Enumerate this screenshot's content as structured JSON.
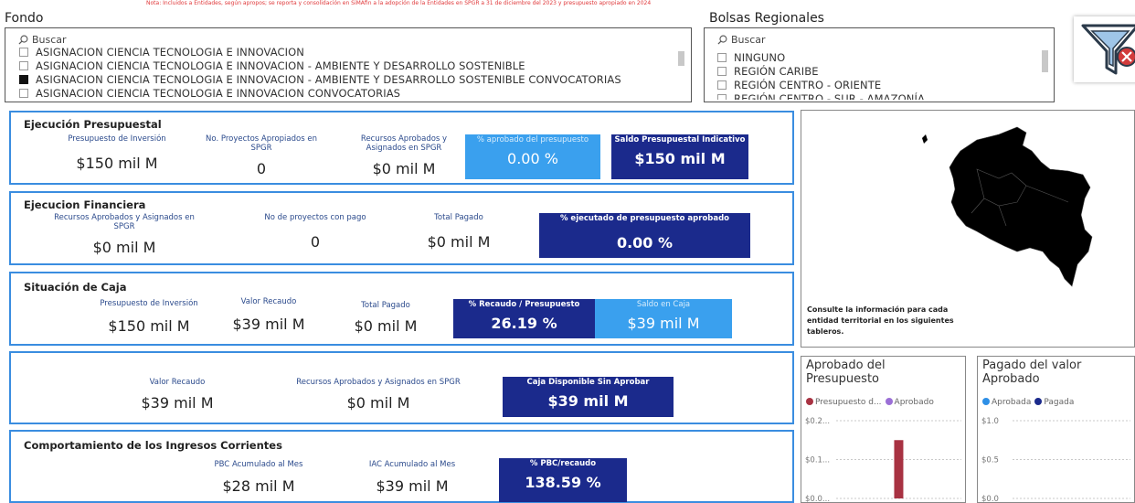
{
  "top_note": "Nota: Incluidos a Entidades, según apropos; se reporta y consolidación en SiMAfin a la adopción de la Entidades en SPGR a 31 de diciembre del 2023 y presupuesto apropiado en 2024",
  "fondo": {
    "title": "Fondo",
    "search_placeholder": "Buscar",
    "items": [
      {
        "label": "ASIGNACION CIENCIA TECNOLOGIA E INNOVACION",
        "checked": false
      },
      {
        "label": "ASIGNACION CIENCIA TECNOLOGIA E INNOVACION - AMBIENTE Y DESARROLLO SOSTENIBLE",
        "checked": false
      },
      {
        "label": "ASIGNACION CIENCIA TECNOLOGIA E INNOVACION - AMBIENTE Y DESARROLLO SOSTENIBLE CONVOCATORIAS",
        "checked": true
      },
      {
        "label": "ASIGNACION CIENCIA TECNOLOGIA E INNOVACION CONVOCATORIAS",
        "checked": false
      }
    ]
  },
  "bolsas": {
    "title": "Bolsas Regionales",
    "search_placeholder": "Buscar",
    "items": [
      {
        "label": "NINGUNO",
        "checked": false
      },
      {
        "label": "REGIÓN CARIBE",
        "checked": false
      },
      {
        "label": "REGIÓN CENTRO - ORIENTE",
        "checked": false
      },
      {
        "label": "REGIÓN CENTRO - SUR - AMAZONÍA",
        "checked": false
      }
    ]
  },
  "ejecucion_presupuestal": {
    "title": "Ejecución Presupuestal",
    "presupuesto_label": "Presupuesto de Inversión",
    "presupuesto_value": "$150 mil M",
    "proyectos_label": "No. Proyectos Apropiados en SPGR",
    "proyectos_value": "0",
    "recursos_label": "Recursos Aprobados y Asignados en SPGR",
    "recursos_value": "$0 mil M",
    "pct_label": "% aprobado del presupuesto",
    "pct_value": "0.00 %",
    "saldo_label": "Saldo Presupuestal Indicativo",
    "saldo_value": "$150 mil M"
  },
  "ejecucion_financiera": {
    "title": "Ejecucion Financiera",
    "recursos_label": "Recursos Aprobados y Asignados en SPGR",
    "recursos_value": "$0 mil M",
    "proyectos_label": "No de proyectos con pago",
    "proyectos_value": "0",
    "pagado_label": "Total Pagado",
    "pagado_value": "$0 mil M",
    "pct_label": "% ejecutado de presupuesto aprobado",
    "pct_value": "0.00 %"
  },
  "situacion_caja": {
    "title": "Situación de Caja",
    "presupuesto_label": "Presupuesto de Inversión",
    "presupuesto_value": "$150 mil M",
    "recaudo_label": "Valor Recaudo",
    "recaudo_value": "$39 mil M",
    "pagado_label": "Total Pagado",
    "pagado_value": "$0 mil M",
    "pct_label": "% Recaudo / Presupuesto",
    "pct_value": "26.19 %",
    "saldo_label": "Saldo en Caja",
    "saldo_value": "$39 mil M"
  },
  "caja_disponible": {
    "recaudo_label": "Valor Recaudo",
    "recaudo_value": "$39 mil M",
    "recursos_label": "Recursos Aprobados y Asignados en SPGR",
    "recursos_value": "$0 mil M",
    "caja_label": "Caja Disponible Sin Aprobar",
    "caja_value": "$39 mil M"
  },
  "ingresos_corrientes": {
    "title": "Comportamiento de los Ingresos Corrientes",
    "pbc_label": "PBC Acumulado al Mes",
    "pbc_value": "$28 mil M",
    "iac_label": "IAC Acumulado al Mes",
    "iac_value": "$39 mil M",
    "pct_label": "% PBC/recaudo",
    "pct_value": "138.59 %"
  },
  "map": {
    "note": "Consulte la información para cada entidad territorial en los siguientes tableros."
  },
  "chart_data": [
    {
      "type": "bar",
      "title": "Aprobado del Presupuesto",
      "series": [
        {
          "name": "Presupuesto d...",
          "color": "#a83242",
          "values": [
            0.15
          ]
        },
        {
          "name": "Aprobado",
          "color": "#9b6fd6",
          "values": [
            0
          ]
        }
      ],
      "yticks": [
        "$0.2...",
        "$0.1...",
        "$0.0..."
      ],
      "ylim": [
        0,
        0.2
      ]
    },
    {
      "type": "bar",
      "title": "Pagado del valor Aprobado",
      "series": [
        {
          "name": "Aprobada",
          "color": "#2e8fe6",
          "values": [
            0
          ]
        },
        {
          "name": "Pagada",
          "color": "#1b2a8c",
          "values": [
            0
          ]
        }
      ],
      "yticks": [
        "$1.0",
        "$0.5",
        "$0.0"
      ],
      "ylim": [
        0,
        1
      ]
    }
  ]
}
